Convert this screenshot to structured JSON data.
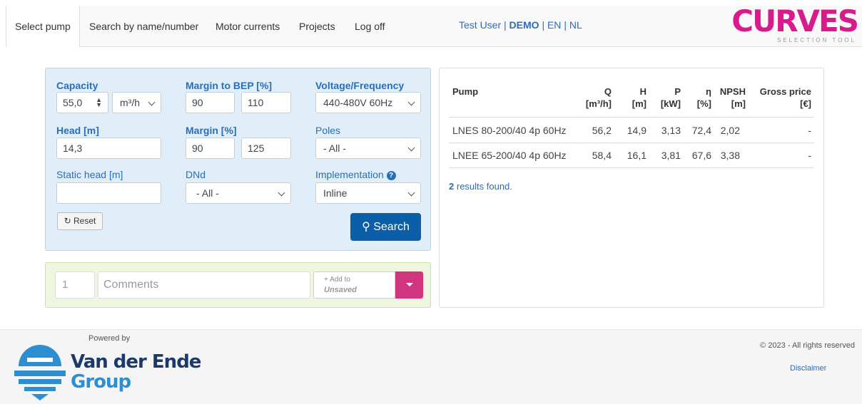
{
  "nav": {
    "tabs": [
      "Select pump",
      "Search by name/number",
      "Motor currents",
      "Projects",
      "Log off"
    ],
    "user": "Test User",
    "sep1": "|",
    "mode": "DEMO",
    "sep2": "|",
    "lang_en": "EN",
    "sep3": "|",
    "lang_nl": "NL",
    "logo_text": "CURVES",
    "logo_subtitle": "SELECTION TOOL"
  },
  "filters": {
    "capacity_label": "Capacity",
    "capacity_value": "55,0",
    "capacity_unit": "m³/h",
    "head_label": "Head [m]",
    "head_value": "14,3",
    "static_head_label": "Static head [m]",
    "static_head_value": "",
    "margin_bep_label": "Margin to BEP [%]",
    "margin_bep_min": "90",
    "margin_bep_max": "110",
    "margin_label": "Margin [%]",
    "margin_min": "90",
    "margin_max": "125",
    "dnd_label": "DNd",
    "dnd_value": "- All -",
    "voltage_label": "Voltage/Frequency",
    "voltage_value": "440-480V 60Hz",
    "poles_label": "Poles",
    "poles_value": "- All -",
    "implementation_label": "Implementation",
    "implementation_value": "Inline",
    "reset_label": "Reset",
    "search_label": "Search"
  },
  "comment": {
    "qty": "1",
    "placeholder": "Comments",
    "add_to": "Add to",
    "project": "Unsaved"
  },
  "results": {
    "headers": [
      {
        "name": "Pump",
        "unit": ""
      },
      {
        "name": "Q",
        "unit": "[m³/h]"
      },
      {
        "name": "H",
        "unit": "[m]"
      },
      {
        "name": "P",
        "unit": "[kW]"
      },
      {
        "name": "η",
        "unit": "[%]"
      },
      {
        "name": "NPSH",
        "unit": "[m]"
      },
      {
        "name": "Gross price",
        "unit": "[€]"
      }
    ],
    "rows": [
      [
        "LNES 80-200/40 4p 60Hz",
        "56,2",
        "14,9",
        "3,13",
        "72,4",
        "2,02",
        "-"
      ],
      [
        "LNEE 65-200/40 4p 60Hz",
        "58,4",
        "16,1",
        "3,81",
        "67,6",
        "3,38",
        "-"
      ]
    ],
    "count": "2",
    "found_text": "results found."
  },
  "footer": {
    "powered_by": "Powered by",
    "brand_line1": "Van der Ende",
    "brand_line2": "Group",
    "copyright": "© 2023 - All rights reserved",
    "disclaimer": "Disclaimer"
  },
  "colors": {
    "link": "#2a6ebb",
    "primary_button": "#0b5ea8",
    "accent": "#d1357f",
    "filter_bg": "#dfeef9",
    "comment_bg": "#eef6df"
  }
}
